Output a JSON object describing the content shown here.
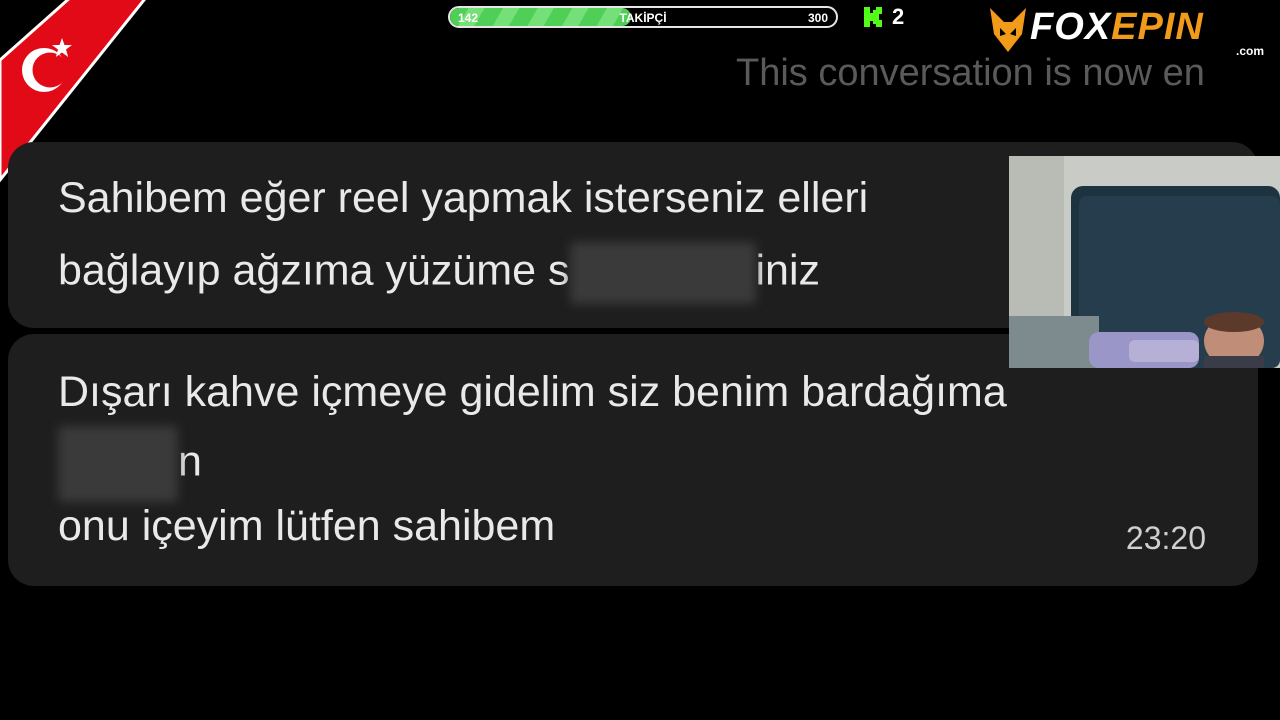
{
  "overlay": {
    "followers": {
      "current": "142",
      "label": "TAKİPÇİ",
      "goal": "300",
      "progress_fraction": 0.47
    },
    "kick": {
      "icon": "kick-logo-icon",
      "count": "2",
      "color": "#53fc18"
    },
    "brand": {
      "part1": "FOX",
      "part2": "EPIN",
      "suffix": ".com",
      "accent": "#f29a1a"
    },
    "flag": "turkey-flag-icon"
  },
  "chat": {
    "ended_note": "This conversation is now en",
    "messages": [
      {
        "line1": "Sahibem eğer reel yapmak isterseniz elleri",
        "line2_start": "bağlayıp ağzıma yüzüme s",
        "line2_end": "iniz"
      },
      {
        "line1": "Dışarı kahve içmeye gidelim siz benim bardağıma",
        "line2_end": "n",
        "line3": "onu içeyim lütfen sahibem",
        "time": "23:20"
      }
    ]
  },
  "colors": {
    "bubble": "#1e1e1e",
    "background": "#000000",
    "flag_red": "#e30a17"
  }
}
